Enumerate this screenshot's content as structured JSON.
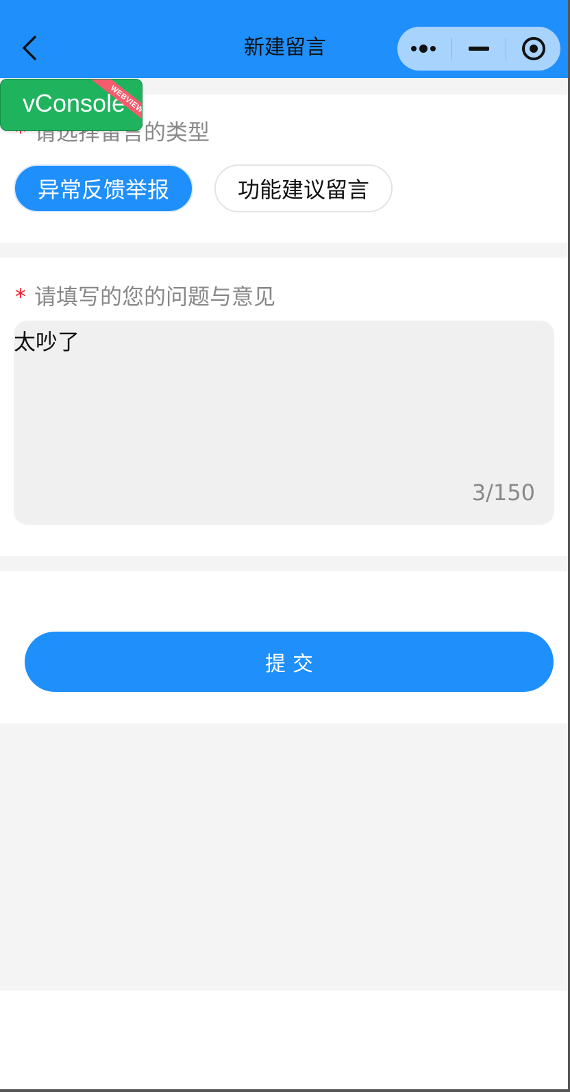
{
  "navbar": {
    "title": "新建留言",
    "background": "#1f8ffb",
    "back_icon": "chevron-left-icon",
    "capsule": {
      "more_icon": "more-dots-icon",
      "minimize_icon": "minimize-icon",
      "close_icon": "target-circle-icon"
    }
  },
  "type_section": {
    "label": "请选择留言的类型",
    "required_mark": "*",
    "options": [
      {
        "label": "异常反馈举报",
        "selected": true
      },
      {
        "label": "功能建议留言",
        "selected": false
      }
    ]
  },
  "content_section": {
    "label": "请填写的您的问题与意见",
    "required_mark": "*",
    "value": "太吵了",
    "counter": "3/150"
  },
  "submit_label": "提交",
  "vconsole": {
    "label": "vConsole",
    "ribbon": "WEBVIEW"
  },
  "colors": {
    "primary": "#1f8ffb",
    "required": "#f5222d",
    "vconsole": "#1fb35d"
  }
}
